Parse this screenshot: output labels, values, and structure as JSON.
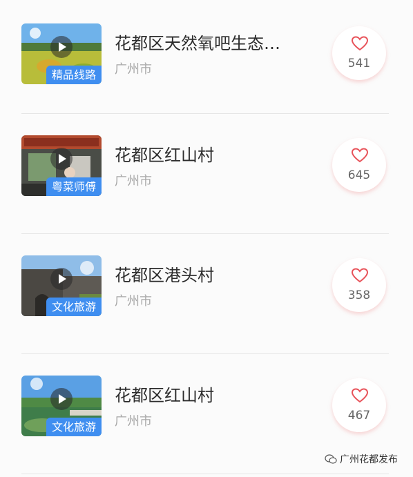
{
  "items": [
    {
      "thumb_tag": "精品线路",
      "title": "花都区天然氧吧生态…",
      "city": "广州市",
      "likes": "541"
    },
    {
      "thumb_tag": "粤菜师傅",
      "title": "花都区红山村",
      "city": "广州市",
      "likes": "645"
    },
    {
      "thumb_tag": "文化旅游",
      "title": "花都区港头村",
      "city": "广州市",
      "likes": "358"
    },
    {
      "thumb_tag": "文化旅游",
      "title": "花都区红山村",
      "city": "广州市",
      "likes": "467"
    }
  ],
  "watermark": {
    "text": "广州花都发布"
  },
  "colors": {
    "tag": "#3f8ef0",
    "heart": "#e8535a"
  }
}
